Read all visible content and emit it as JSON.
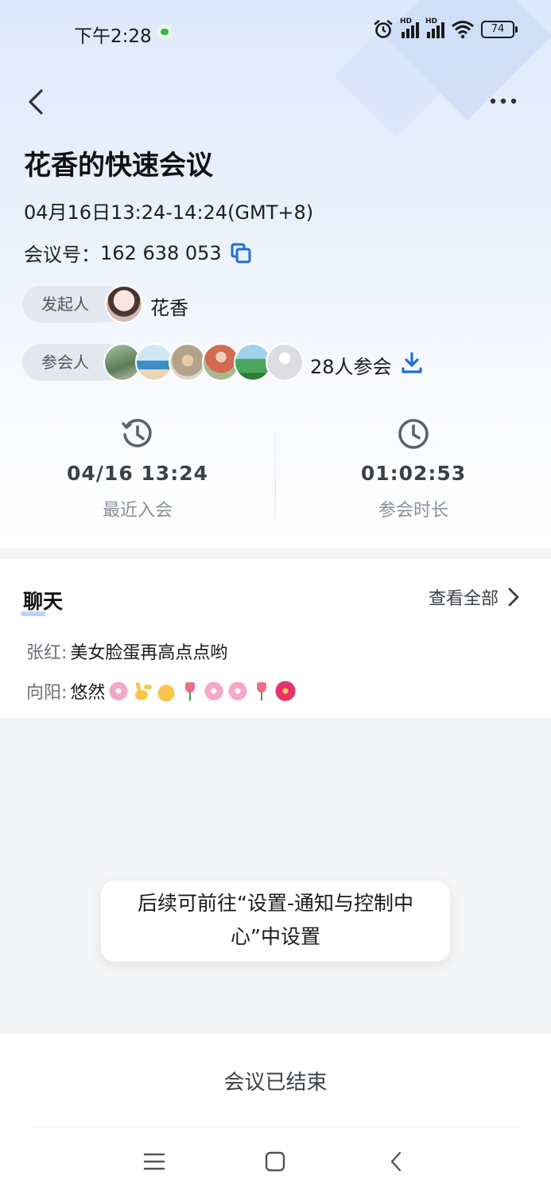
{
  "status_bar": {
    "time": "下午2:28",
    "battery": "74",
    "signal_label": "HD"
  },
  "meeting": {
    "title": "花香的快速会议",
    "time_range": "04月16日13:24-14:24(GMT+8)",
    "id_label": "会议号：",
    "id_value": "162 638 053"
  },
  "host": {
    "label": "发起人",
    "name": "花香"
  },
  "attendees": {
    "label": "参会人",
    "count_text": "28人参会",
    "avatars": [
      "#6f8f6a",
      "#7fb6d8",
      "#b9a68c",
      "#c7866f",
      "#4aa65a",
      "#dcdde0"
    ]
  },
  "stats": {
    "last_join": {
      "value": "04/16 13:24",
      "label": "最近入会"
    },
    "duration": {
      "value": "01:02:53",
      "label": "参会时长"
    }
  },
  "chat": {
    "title": "聊天",
    "view_all": "查看全部",
    "messages": [
      {
        "sender": "张红:",
        "text": "美女脸蛋再高点点哟"
      },
      {
        "sender": "向阳:",
        "text": "悠然"
      }
    ]
  },
  "toast": {
    "line1": "后续可前往“设置-通知与控制中",
    "line2": "心”中设置"
  },
  "footer": {
    "ended_label": "会议已结束"
  },
  "colors": {
    "accent": "#1e6fd8",
    "icon_gray": "#5b6270"
  }
}
